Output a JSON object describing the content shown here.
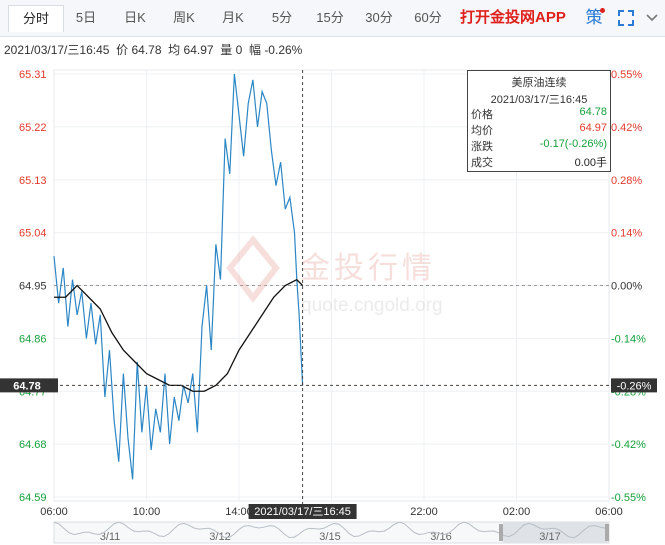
{
  "tabs": [
    {
      "label": "分时",
      "active": true
    },
    {
      "label": "5日"
    },
    {
      "label": "日K"
    },
    {
      "label": "周K"
    },
    {
      "label": "月K"
    },
    {
      "label": "5分"
    },
    {
      "label": "15分"
    },
    {
      "label": "30分"
    },
    {
      "label": "60分"
    }
  ],
  "app_link": "打开金投网APP",
  "icons": {
    "strategy": "策",
    "fullscreen": "fullscreen-icon"
  },
  "info": {
    "datetime": "2021/03/17/三16:45",
    "price_label": "价",
    "price": "64.78",
    "avg_label": "均",
    "avg": "64.97",
    "vol_label": "量",
    "vol": "0",
    "chg_label": "幅",
    "chg": "-0.26%"
  },
  "legend": {
    "title": "美原油连续",
    "datetime": "2021/03/17/三16:45",
    "rows": [
      {
        "label": "价格",
        "value": "64.78",
        "color": "#16a03b"
      },
      {
        "label": "均价",
        "value": "64.97",
        "color": "#e23a2c"
      },
      {
        "label": "涨跌",
        "value": "-0.17(-0.26%)",
        "color": "#16a03b"
      },
      {
        "label": "成交",
        "value": "0.00手",
        "color": "#222222"
      }
    ]
  },
  "watermark": {
    "text": "金投行情",
    "url": "quote.cngold.org"
  },
  "colors": {
    "up": "#e23a2c",
    "down": "#16a03b",
    "price_line": "#2b86c5",
    "avg_line": "#111111"
  },
  "chart_data": {
    "type": "line",
    "y_ticks": [
      "65.31",
      "65.22",
      "65.13",
      "65.04",
      "64.95",
      "64.86",
      "64.77",
      "64.68",
      "64.59"
    ],
    "pct_ticks": [
      "0.55%",
      "0.42%",
      "0.28%",
      "0.14%",
      "0.00%",
      "-0.14%",
      "-0.28%",
      "-0.42%",
      "-0.55%"
    ],
    "x_ticks": [
      "06:00",
      "10:00",
      "14:00",
      "18:00",
      "22:00",
      "02:00",
      "06:00"
    ],
    "x_hours": [
      6,
      10,
      14,
      18,
      22,
      26,
      30
    ],
    "ylim": [
      64.59,
      65.31
    ],
    "xlim_hours": [
      6,
      30
    ],
    "prev_close": 64.95,
    "current_price": 64.78,
    "current_price_label": "64.78",
    "current_pct_label": "-0.26%",
    "crosshair_label": "2021/03/17/三16:45",
    "crosshair_hour": 16.75,
    "price_series": {
      "hours": [
        6.0,
        6.2,
        6.4,
        6.6,
        6.8,
        7.0,
        7.2,
        7.4,
        7.6,
        7.8,
        8.0,
        8.2,
        8.4,
        8.6,
        8.8,
        9.0,
        9.2,
        9.4,
        9.6,
        9.8,
        10.0,
        10.2,
        10.4,
        10.6,
        10.8,
        11.0,
        11.2,
        11.4,
        11.6,
        11.8,
        12.0,
        12.2,
        12.4,
        12.6,
        12.8,
        13.0,
        13.2,
        13.4,
        13.6,
        13.8,
        14.0,
        14.2,
        14.4,
        14.6,
        14.8,
        15.0,
        15.2,
        15.4,
        15.6,
        15.8,
        16.0,
        16.2,
        16.4,
        16.5,
        16.6,
        16.75
      ],
      "values": [
        65.0,
        64.92,
        64.98,
        64.88,
        64.96,
        64.9,
        64.94,
        64.86,
        64.92,
        64.85,
        64.9,
        64.76,
        64.84,
        64.72,
        64.65,
        64.8,
        64.69,
        64.62,
        64.82,
        64.7,
        64.78,
        64.67,
        64.74,
        64.7,
        64.8,
        64.68,
        64.76,
        64.72,
        64.78,
        64.75,
        64.8,
        64.7,
        64.88,
        64.95,
        64.84,
        65.02,
        64.96,
        65.2,
        65.14,
        65.31,
        65.24,
        65.17,
        65.26,
        65.3,
        65.22,
        65.28,
        65.26,
        65.18,
        65.12,
        65.16,
        65.08,
        65.1,
        65.04,
        64.96,
        64.9,
        64.78
      ]
    },
    "avg_series": {
      "hours": [
        6.0,
        6.5,
        7.0,
        7.5,
        8.0,
        8.5,
        9.0,
        9.5,
        10.0,
        10.5,
        11.0,
        11.5,
        12.0,
        12.5,
        13.0,
        13.5,
        14.0,
        14.5,
        15.0,
        15.5,
        16.0,
        16.5,
        16.75
      ],
      "values": [
        64.93,
        64.93,
        64.95,
        64.93,
        64.91,
        64.87,
        64.84,
        64.82,
        64.8,
        64.79,
        64.78,
        64.78,
        64.77,
        64.77,
        64.78,
        64.8,
        64.84,
        64.87,
        64.9,
        64.93,
        64.95,
        64.96,
        64.95
      ]
    },
    "navigator": {
      "dates": [
        "3/11",
        "3/12",
        "3/15",
        "3/16",
        "3/17"
      ]
    }
  }
}
